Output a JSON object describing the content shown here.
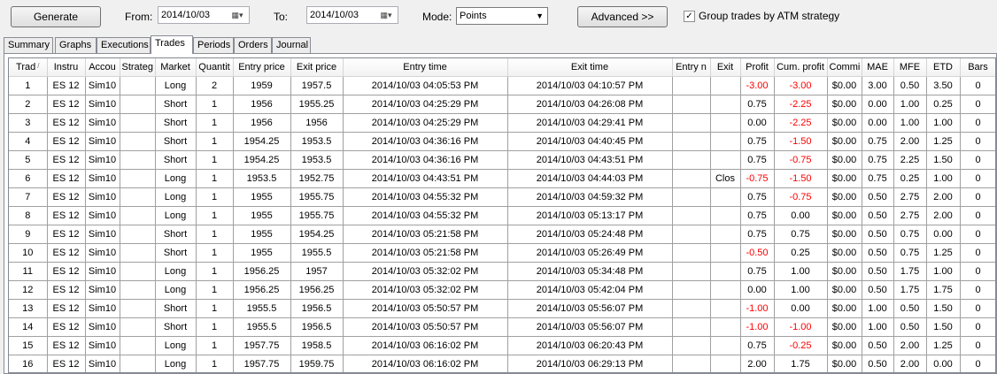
{
  "toolbar": {
    "generate_label": "Generate",
    "from_label": "From:",
    "from_value": "2014/10/03",
    "to_label": "To:",
    "to_value": "2014/10/03",
    "mode_label": "Mode:",
    "mode_value": "Points",
    "advanced_label": "Advanced >>",
    "group_label": "Group trades by ATM strategy",
    "group_checked": "✓"
  },
  "tabs": [
    "Summary",
    "Graphs",
    "Executions",
    "Trades",
    "Periods",
    "Orders",
    "Journal"
  ],
  "active_tab": "Trades",
  "table": {
    "columns": [
      "Trad",
      "Instru",
      "Accou",
      "Strateg",
      "Market",
      "Quantit",
      "Entry price",
      "Exit price",
      "Entry time",
      "Exit time",
      "Entry n",
      "Exit",
      "Profit",
      "Cum. profit",
      "Commi",
      "MAE",
      "MFE",
      "ETD",
      "Bars"
    ],
    "sort_indicator": "/",
    "negative_color": "#ff0000",
    "rows": [
      [
        "1",
        "ES 12",
        "Sim10",
        "",
        "Long",
        "2",
        "1959",
        "1957.5",
        "2014/10/03 04:05:53 PM",
        "2014/10/03 04:10:57 PM",
        "",
        "",
        "-3.00",
        "-3.00",
        "$0.00",
        "3.00",
        "0.50",
        "3.50",
        "0"
      ],
      [
        "2",
        "ES 12",
        "Sim10",
        "",
        "Short",
        "1",
        "1956",
        "1955.25",
        "2014/10/03 04:25:29 PM",
        "2014/10/03 04:26:08 PM",
        "",
        "",
        "0.75",
        "-2.25",
        "$0.00",
        "0.00",
        "1.00",
        "0.25",
        "0"
      ],
      [
        "3",
        "ES 12",
        "Sim10",
        "",
        "Short",
        "1",
        "1956",
        "1956",
        "2014/10/03 04:25:29 PM",
        "2014/10/03 04:29:41 PM",
        "",
        "",
        "0.00",
        "-2.25",
        "$0.00",
        "0.00",
        "1.00",
        "1.00",
        "0"
      ],
      [
        "4",
        "ES 12",
        "Sim10",
        "",
        "Short",
        "1",
        "1954.25",
        "1953.5",
        "2014/10/03 04:36:16 PM",
        "2014/10/03 04:40:45 PM",
        "",
        "",
        "0.75",
        "-1.50",
        "$0.00",
        "0.75",
        "2.00",
        "1.25",
        "0"
      ],
      [
        "5",
        "ES 12",
        "Sim10",
        "",
        "Short",
        "1",
        "1954.25",
        "1953.5",
        "2014/10/03 04:36:16 PM",
        "2014/10/03 04:43:51 PM",
        "",
        "",
        "0.75",
        "-0.75",
        "$0.00",
        "0.75",
        "2.25",
        "1.50",
        "0"
      ],
      [
        "6",
        "ES 12",
        "Sim10",
        "",
        "Long",
        "1",
        "1953.5",
        "1952.75",
        "2014/10/03 04:43:51 PM",
        "2014/10/03 04:44:03 PM",
        "",
        "Clos",
        "-0.75",
        "-1.50",
        "$0.00",
        "0.75",
        "0.25",
        "1.00",
        "0"
      ],
      [
        "7",
        "ES 12",
        "Sim10",
        "",
        "Long",
        "1",
        "1955",
        "1955.75",
        "2014/10/03 04:55:32 PM",
        "2014/10/03 04:59:32 PM",
        "",
        "",
        "0.75",
        "-0.75",
        "$0.00",
        "0.50",
        "2.75",
        "2.00",
        "0"
      ],
      [
        "8",
        "ES 12",
        "Sim10",
        "",
        "Long",
        "1",
        "1955",
        "1955.75",
        "2014/10/03 04:55:32 PM",
        "2014/10/03 05:13:17 PM",
        "",
        "",
        "0.75",
        "0.00",
        "$0.00",
        "0.50",
        "2.75",
        "2.00",
        "0"
      ],
      [
        "9",
        "ES 12",
        "Sim10",
        "",
        "Short",
        "1",
        "1955",
        "1954.25",
        "2014/10/03 05:21:58 PM",
        "2014/10/03 05:24:48 PM",
        "",
        "",
        "0.75",
        "0.75",
        "$0.00",
        "0.50",
        "0.75",
        "0.00",
        "0"
      ],
      [
        "10",
        "ES 12",
        "Sim10",
        "",
        "Short",
        "1",
        "1955",
        "1955.5",
        "2014/10/03 05:21:58 PM",
        "2014/10/03 05:26:49 PM",
        "",
        "",
        "-0.50",
        "0.25",
        "$0.00",
        "0.50",
        "0.75",
        "1.25",
        "0"
      ],
      [
        "11",
        "ES 12",
        "Sim10",
        "",
        "Long",
        "1",
        "1956.25",
        "1957",
        "2014/10/03 05:32:02 PM",
        "2014/10/03 05:34:48 PM",
        "",
        "",
        "0.75",
        "1.00",
        "$0.00",
        "0.50",
        "1.75",
        "1.00",
        "0"
      ],
      [
        "12",
        "ES 12",
        "Sim10",
        "",
        "Long",
        "1",
        "1956.25",
        "1956.25",
        "2014/10/03 05:32:02 PM",
        "2014/10/03 05:42:04 PM",
        "",
        "",
        "0.00",
        "1.00",
        "$0.00",
        "0.50",
        "1.75",
        "1.75",
        "0"
      ],
      [
        "13",
        "ES 12",
        "Sim10",
        "",
        "Short",
        "1",
        "1955.5",
        "1956.5",
        "2014/10/03 05:50:57 PM",
        "2014/10/03 05:56:07 PM",
        "",
        "",
        "-1.00",
        "0.00",
        "$0.00",
        "1.00",
        "0.50",
        "1.50",
        "0"
      ],
      [
        "14",
        "ES 12",
        "Sim10",
        "",
        "Short",
        "1",
        "1955.5",
        "1956.5",
        "2014/10/03 05:50:57 PM",
        "2014/10/03 05:56:07 PM",
        "",
        "",
        "-1.00",
        "-1.00",
        "$0.00",
        "1.00",
        "0.50",
        "1.50",
        "0"
      ],
      [
        "15",
        "ES 12",
        "Sim10",
        "",
        "Long",
        "1",
        "1957.75",
        "1958.5",
        "2014/10/03 06:16:02 PM",
        "2014/10/03 06:20:43 PM",
        "",
        "",
        "0.75",
        "-0.25",
        "$0.00",
        "0.50",
        "2.00",
        "1.25",
        "0"
      ],
      [
        "16",
        "ES 12",
        "Sim10",
        "",
        "Long",
        "1",
        "1957.75",
        "1959.75",
        "2014/10/03 06:16:02 PM",
        "2014/10/03 06:29:13 PM",
        "",
        "",
        "2.00",
        "1.75",
        "$0.00",
        "0.50",
        "2.00",
        "0.00",
        "0"
      ]
    ]
  }
}
